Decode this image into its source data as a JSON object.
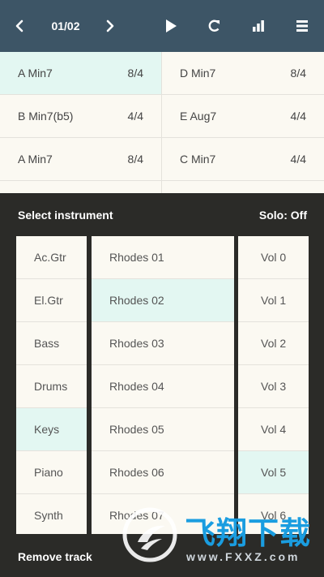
{
  "toolbar": {
    "page_indicator": "01/02",
    "icons": [
      "chevron-left-icon",
      "chevron-right-icon",
      "play-icon",
      "refresh-icon",
      "bar-chart-icon",
      "menu-icon"
    ]
  },
  "chords": [
    [
      {
        "name": "A Min7",
        "meter": "8/4",
        "active": true
      },
      {
        "name": "D Min7",
        "meter": "8/4"
      }
    ],
    [
      {
        "name": "B Min7(b5)",
        "meter": "4/4"
      },
      {
        "name": "E Aug7",
        "meter": "4/4"
      }
    ],
    [
      {
        "name": "A Min7",
        "meter": "8/4"
      },
      {
        "name": "C Min7",
        "meter": "4/4"
      }
    ]
  ],
  "panel": {
    "title": "Select instrument",
    "solo": "Solo: Off",
    "instruments": [
      "Ac.Gtr",
      "El.Gtr",
      "Bass",
      "Drums",
      "Keys",
      "Piano",
      "Synth"
    ],
    "selected_instrument": "Keys",
    "patches": [
      "Rhodes 01",
      "Rhodes 02",
      "Rhodes 03",
      "Rhodes 04",
      "Rhodes 05",
      "Rhodes 06",
      "Rhodes 07"
    ],
    "selected_patch": "Rhodes 02",
    "volumes": [
      "Vol 0",
      "Vol 1",
      "Vol 2",
      "Vol 3",
      "Vol 4",
      "Vol 5",
      "Vol 6"
    ],
    "selected_volume": "Vol 5",
    "remove_track": "Remove track"
  },
  "watermark": {
    "text": "飞翔下载",
    "url": "www.FXXZ.com"
  },
  "colors": {
    "toolbar_bg": "#3d5566",
    "panel_bg": "#2b2b28",
    "cell_bg": "#fbf9f2",
    "selected_bg": "#e3f7f2",
    "watermark_blue": "#1a9de0"
  }
}
